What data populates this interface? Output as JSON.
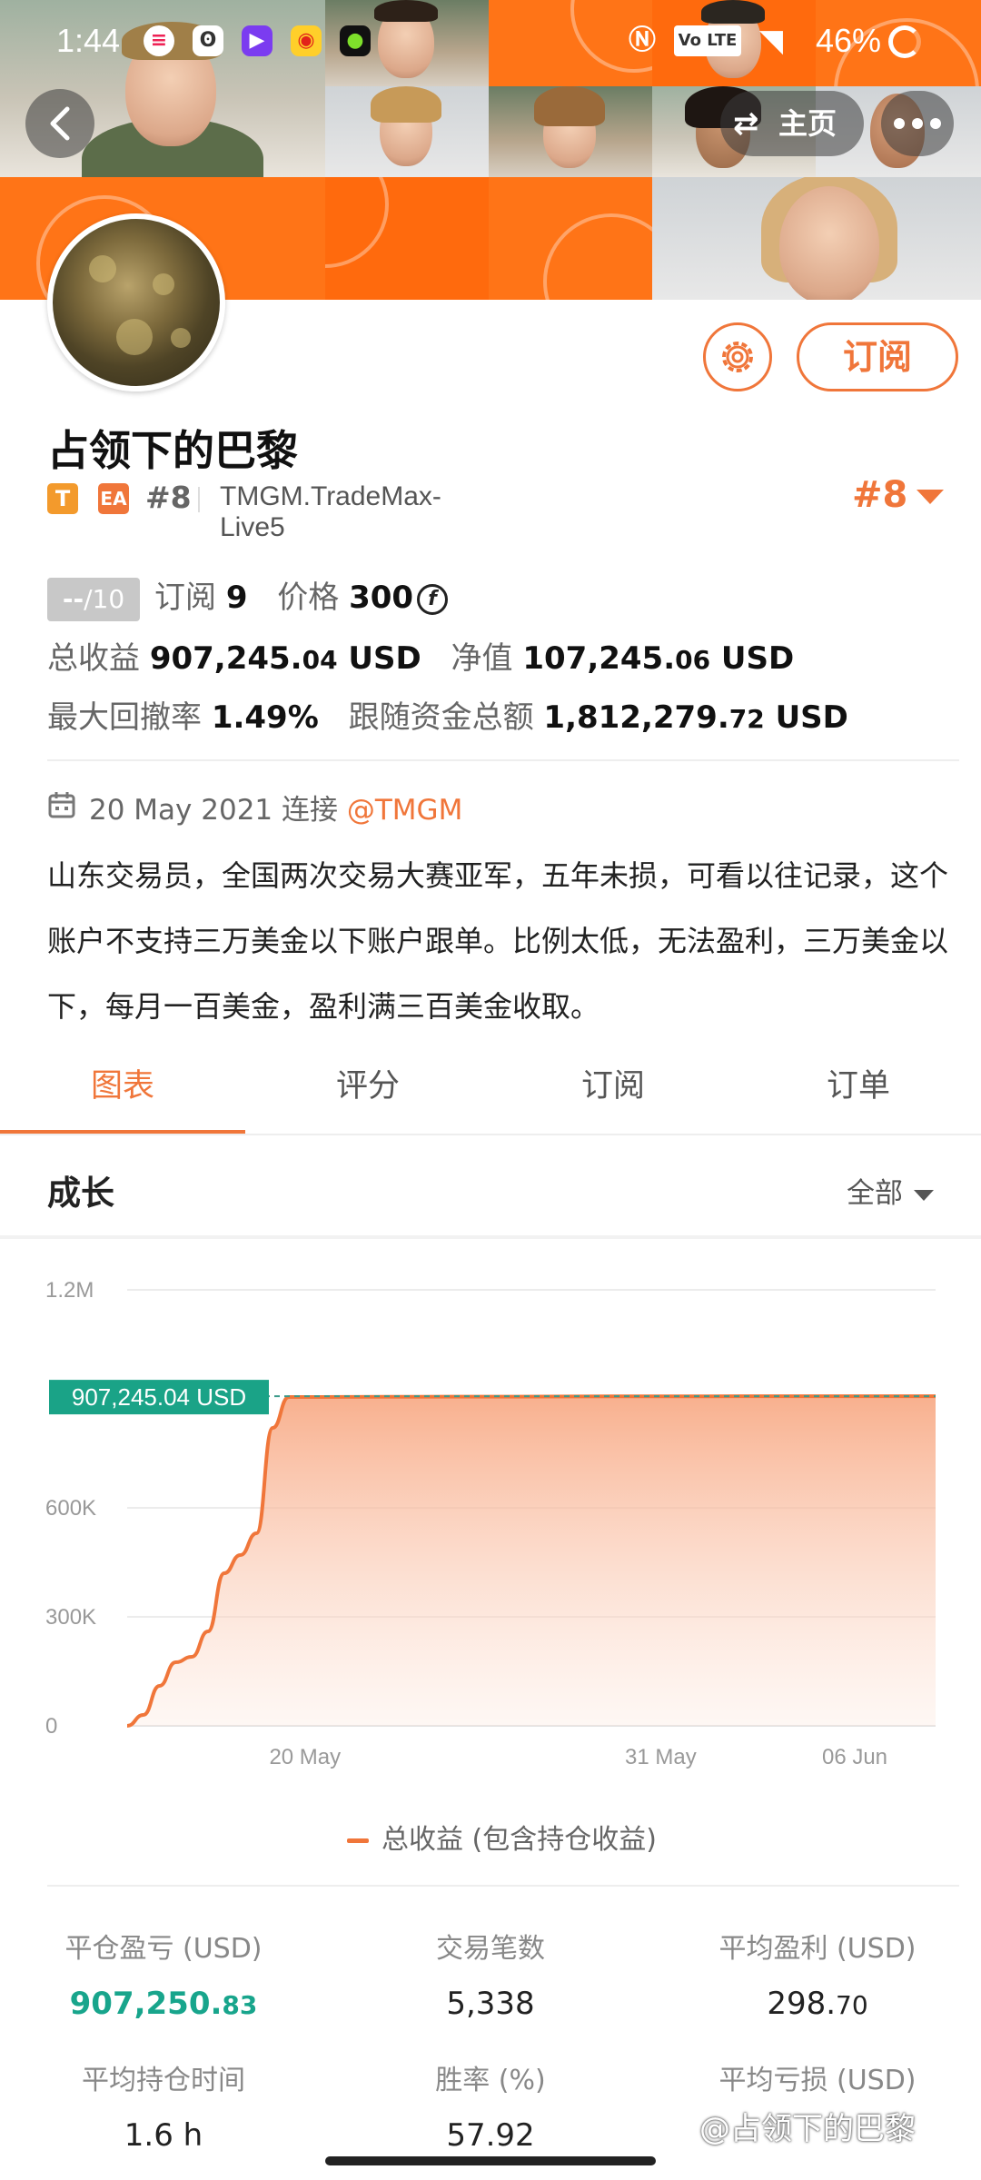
{
  "status_bar": {
    "time": "1:44",
    "battery": "46%",
    "network": "Vo LTE"
  },
  "header": {
    "home_label": "主页",
    "home_icon": "swap-icon",
    "back_icon": "chevron-left-icon",
    "more_icon": "more-dots-icon"
  },
  "profile": {
    "name": "占领下的巴黎",
    "badges": [
      "T",
      "EA"
    ],
    "rank_small": "#8",
    "server": "TMGM.TradeMax-Live5",
    "rank_big": "#8",
    "subscribe_label": "订阅",
    "settings_icon": "gear-icon"
  },
  "metrics": {
    "score_main": "--",
    "score_total": "/10",
    "subscribers_label": "订阅",
    "subscribers": "9",
    "price_label": "价格",
    "price": "300",
    "total_profit_label": "总收益",
    "total_profit_int": "907,245.",
    "total_profit_dec": "04",
    "total_profit_unit": " USD",
    "net_value_label": "净值",
    "net_value_int": "107,245.",
    "net_value_dec": "06",
    "net_value_unit": " USD",
    "max_drawdown_label": "最大回撤率",
    "max_drawdown": "1.49%",
    "follow_funds_label": "跟随资金总额",
    "follow_funds_int": "1,812,279.",
    "follow_funds_dec": "72",
    "follow_funds_unit": " USD"
  },
  "connection": {
    "date": "20 May 2021",
    "connect_label": "连接",
    "handle": "@TMGM"
  },
  "description": "山东交易员，全国两次交易大赛亚军，五年未损，可看以往记录，这个账户不支持三万美金以下账户跟单。比例太低，无法盈利，三万美金以下，每月一百美金，盈利满三百美金收取。",
  "tabs": [
    "图表",
    "评分",
    "订阅",
    "订单"
  ],
  "section": {
    "title": "成长",
    "range": "全部"
  },
  "chart_data": {
    "type": "area",
    "y_ticks": [
      "1.2M",
      "600K",
      "300K",
      "0"
    ],
    "y_tick_values": [
      1200000,
      600000,
      300000,
      0
    ],
    "ylim": [
      0,
      1200000
    ],
    "x_ticks": [
      "20 May",
      "31 May",
      "06 Jun"
    ],
    "x_tick_positions": [
      5.5,
      16.5,
      22.5
    ],
    "xlim": [
      0,
      25
    ],
    "current_label": "907,245.04 USD",
    "current_value": 907245.04,
    "series": [
      {
        "name": "总收益 (包含持仓收益)",
        "x": [
          0,
          0.5,
          1,
          1.5,
          2,
          2.5,
          3,
          3.5,
          4,
          4.5,
          5,
          6,
          8,
          10,
          12,
          14,
          16,
          18,
          20,
          22,
          24,
          25
        ],
        "values": [
          0,
          30000,
          110000,
          175000,
          190000,
          260000,
          420000,
          470000,
          530000,
          820000,
          905000,
          905000,
          905500,
          906000,
          906000,
          906500,
          907000,
          907000,
          907100,
          907200,
          907245,
          907245
        ]
      }
    ],
    "color": "#f0763a"
  },
  "legend_label": "总收益 (包含持仓收益)",
  "stats": [
    {
      "label": "平仓盈亏 (USD)",
      "int": "907,250.",
      "dec": "83",
      "green": true
    },
    {
      "label": "交易笔数",
      "int": "5,338",
      "dec": "",
      "green": false
    },
    {
      "label": "平均盈利 (USD)",
      "int": "298.",
      "dec": "70",
      "green": false
    },
    {
      "label": "平均持仓时间",
      "int": "1.6 h",
      "dec": "",
      "green": false
    },
    {
      "label": "胜率 (%)",
      "int": "57.92",
      "dec": "",
      "green": false
    },
    {
      "label": "平均亏损 (USD)",
      "int": "",
      "dec": "",
      "green": false
    }
  ],
  "watermark": "@占领下的巴黎"
}
